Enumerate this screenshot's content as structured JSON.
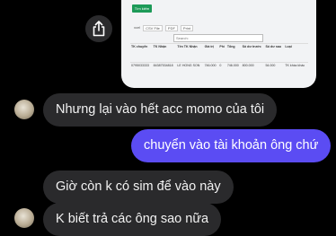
{
  "attachment": {
    "green_button": "Tìm kiếm",
    "export_label": "xcel",
    "export_buttons": [
      "CSV File",
      "PDF",
      "Print"
    ],
    "search_placeholder": "Search:",
    "table": {
      "headers": [
        "TK chuyển",
        "TK Nhận",
        "Tên TK Nhận",
        "Giá trị",
        "Phí",
        "Tổng",
        "Số dư trước",
        "Số dư sau",
        "Loại"
      ],
      "row": [
        "0795033333",
        "84387534818",
        "LE HONG SON",
        "746.000",
        "0",
        "746.000",
        "800.000",
        "54.000",
        "TK khác khác"
      ]
    }
  },
  "share_icon": "share-icon",
  "messages": [
    {
      "side": "incoming",
      "text": "Nhưng lại vào hết acc momo của tôi"
    },
    {
      "side": "outgoing",
      "text": "chuyển vào tài khoản ông chứ"
    },
    {
      "side": "incoming",
      "text": "Giờ còn k có sim để vào này"
    },
    {
      "side": "incoming",
      "text": "K biết trả các ông sao nữa"
    }
  ],
  "colors": {
    "outgoing_bubble": "#5b4cf3",
    "incoming_bubble": "#2a2a2c",
    "background": "#000000"
  }
}
